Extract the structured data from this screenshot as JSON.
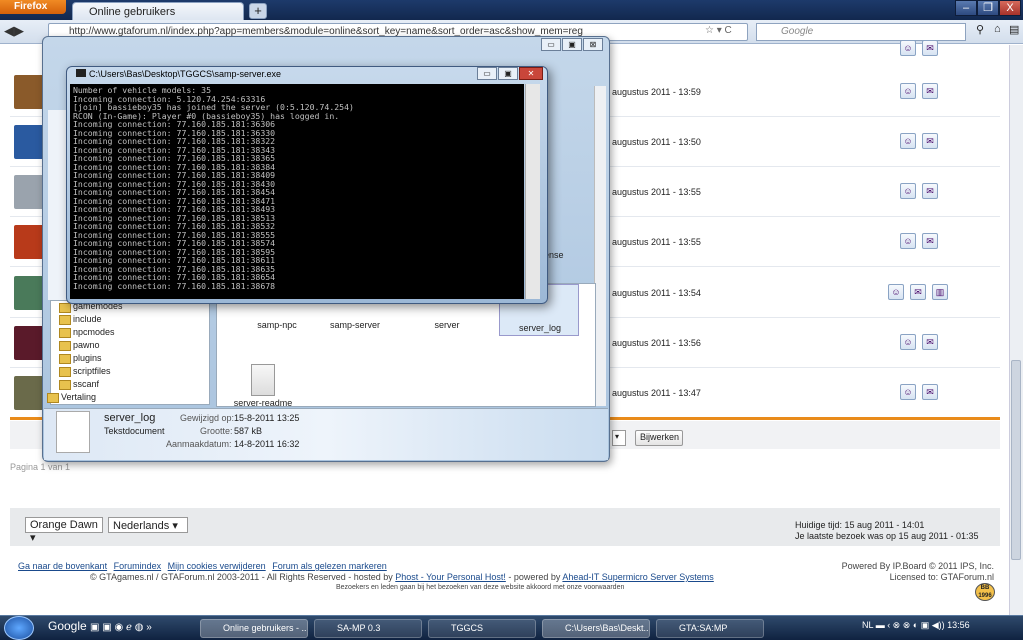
{
  "browser": {
    "app_button": "Firefox",
    "tab_title": "Online gebruikers",
    "new_tab": "+",
    "url": "http://www.gtaforum.nl/index.php?app=members&module=online&sort_key=name&sort_order=asc&show_mem=reg",
    "search_placeholder": "Google",
    "win_minimize": "–",
    "win_maximize": "❐",
    "win_close": "X"
  },
  "forum_rows": [
    {
      "time": "augustus 2011 - 13:59"
    },
    {
      "time": "augustus 2011 - 13:50"
    },
    {
      "time": "augustus 2011 - 13:55"
    },
    {
      "time": "augustus 2011 - 13:55"
    },
    {
      "time": "augustus 2011 - 13:54"
    },
    {
      "time": "augustus 2011 - 13:56"
    },
    {
      "time": "augustus 2011 - 13:47"
    }
  ],
  "update_button": "Bijwerken",
  "pagination": "Pagina 1 van 1",
  "skin_select": "Orange Dawn",
  "lang_select": "Nederlands",
  "huidige_tijd": "Huidige tijd: 15 aug 2011 - 14:01",
  "laatste_bezoek": "Je laatste bezoek was op 15 aug 2011 - 01:35",
  "footer": {
    "links": [
      "Ga naar de bovenkant",
      "Forumindex",
      "Mijn cookies verwijderen",
      "Forum als gelezen markeren"
    ],
    "copyright_pre": "© GTAgames.nl / GTAForum.nl 2003-2011 - All Rights Reserved - hosted by",
    "host_link": "Phost - Your Personal Host!",
    "powered_mid": "- powered by",
    "server_link": "Ahead-IT Supermicro Server Systems",
    "bezoek": "Bezoekers en leden gaan bij het bezoeken van deze website akkoord met onze voorwaarden",
    "powered_by": "Powered By IP.Board © 2011 IPS, Inc.",
    "licensed": "Licensed to: GTAForum.nl",
    "badge": "BB 1996"
  },
  "explorer": {
    "tree_items": [
      "include",
      "npcmodes",
      "pawno",
      "plugins",
      "scriptfiles",
      "sscanf",
      "Vertaling"
    ],
    "tree_partial": "gamemodes",
    "files": [
      "samp-npc",
      "samp-server",
      "server",
      "server_log",
      "server-readme"
    ],
    "license_partial": "ense",
    "detail_name": "server_log",
    "detail_type": "Tekstdocument",
    "detail_modified_label": "Gewijzigd op:",
    "detail_modified": "15-8-2011 13:25",
    "detail_size_label": "Grootte:",
    "detail_size": "587 kB",
    "detail_created_label": "Aanmaakdatum:",
    "detail_created": "14-8-2011 16:32"
  },
  "console": {
    "title": "C:\\Users\\Bas\\Desktop\\TGGCS\\samp-server.exe",
    "lines": "Number of vehicle models: 35\nIncoming connection: 5.120.74.254:63316\n[join] bassieboy35 has joined the server (0:5.120.74.254)\nRCON (In-Game): Player #0 (bassieboy35) has logged in.\nIncoming connection: 77.160.185.181:36306\nIncoming connection: 77.160.185.181:36330\nIncoming connection: 77.160.185.181:38322\nIncoming connection: 77.160.185.181:38343\nIncoming connection: 77.160.185.181:38365\nIncoming connection: 77.160.185.181:38384\nIncoming connection: 77.160.185.181:38409\nIncoming connection: 77.160.185.181:38430\nIncoming connection: 77.160.185.181:38454\nIncoming connection: 77.160.185.181:38471\nIncoming connection: 77.160.185.181:38493\nIncoming connection: 77.160.185.181:38513\nIncoming connection: 77.160.185.181:38532\nIncoming connection: 77.160.185.181:38555\nIncoming connection: 77.160.185.181:38574\nIncoming connection: 77.160.185.181:38595\nIncoming connection: 77.160.185.181:38611\nIncoming connection: 77.160.185.181:38635\nIncoming connection: 77.160.185.181:38654\nIncoming connection: 77.160.185.181:38678"
  },
  "taskbar": {
    "google": "Google",
    "items": [
      "Online gebruikers - ...",
      "SA-MP 0.3",
      "TGGCS",
      "C:\\Users\\Bas\\Deskt...",
      "GTA:SA:MP"
    ],
    "lang": "NL",
    "clock": "13:56"
  }
}
